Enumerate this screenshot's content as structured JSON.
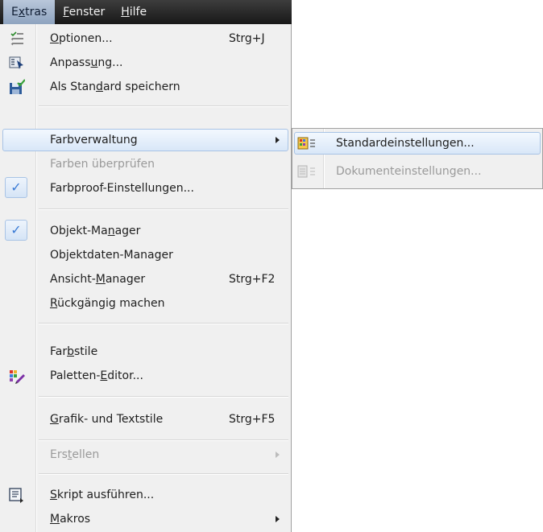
{
  "menubar": {
    "items": [
      {
        "pre": "E",
        "u": "x",
        "post": "tras"
      },
      {
        "pre": "",
        "u": "F",
        "post": "enster"
      },
      {
        "pre": "",
        "u": "H",
        "post": "ilfe"
      }
    ]
  },
  "menu": {
    "items": [
      {
        "pre": "",
        "u": "O",
        "post": "ptionen...",
        "shortcut": "Strg+J",
        "icon": "options-icon"
      },
      {
        "pre": "Anpass",
        "u": "u",
        "post": "ng...",
        "icon": "customize-icon"
      },
      {
        "pre": "Als Stan",
        "u": "d",
        "post": "ard speichern",
        "icon": "save-default-icon"
      },
      {
        "label": "Farbverwaltung"
      },
      {
        "label": "Farben überprüfen"
      },
      {
        "label": "Farbproof-Einstellungen...",
        "check": "✓"
      },
      {
        "pre": "Objekt-Ma",
        "u": "n",
        "post": "ager",
        "check": "✓"
      },
      {
        "label": "Objektdaten-Manager"
      },
      {
        "pre": "Ansicht-",
        "u": "M",
        "post": "anager",
        "shortcut": "Strg+F2"
      },
      {
        "pre": "",
        "u": "R",
        "post": "ückgängig machen"
      },
      {
        "pre": "Far",
        "u": "b",
        "post": "stile"
      },
      {
        "pre": "Paletten-",
        "u": "E",
        "post": "ditor...",
        "icon": "palette-editor-icon"
      },
      {
        "pre": "",
        "u": "G",
        "post": "rafik- und Textstile",
        "shortcut": "Strg+F5"
      },
      {
        "pre": "Ers",
        "u": "t",
        "post": "ellen"
      },
      {
        "pre": "",
        "u": "S",
        "post": "kript ausführen...",
        "icon": "script-icon"
      },
      {
        "pre": "",
        "u": "M",
        "post": "akros"
      }
    ]
  },
  "submenu": {
    "items": [
      {
        "label": "Standardeinstellungen...",
        "icon": "default-settings-icon"
      },
      {
        "label": "Dokumenteinstellungen...",
        "icon": "document-settings-icon"
      }
    ]
  },
  "colors": {
    "highlight_border": "#a8c3e5",
    "check": "#3a7bd5",
    "disabled": "#9a9a9a"
  }
}
